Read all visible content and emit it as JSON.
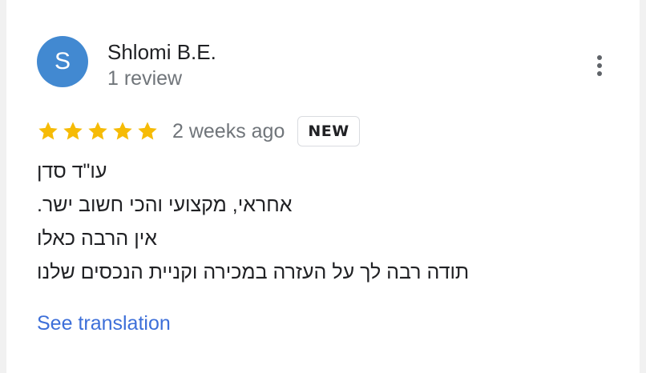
{
  "review": {
    "author": {
      "initial": "S",
      "name": "Shlomi B.E.",
      "review_count": "1 review",
      "avatar_color": "#4289d1"
    },
    "menu_icon": "more-vert-icon",
    "rating": 5,
    "max_rating": 5,
    "star_color": "#f6bb06",
    "time": "2 weeks ago",
    "badge": "NEW",
    "lines": [
      "עו\"ד סדן",
      "אחראי, מקצועי והכי חשוב ישר.",
      "אין הרבה כאלו",
      "תודה רבה לך על העזרה במכירה וקניית הנכסים שלנו"
    ],
    "translate_label": "See translation",
    "link_color": "#3d6fd9"
  }
}
